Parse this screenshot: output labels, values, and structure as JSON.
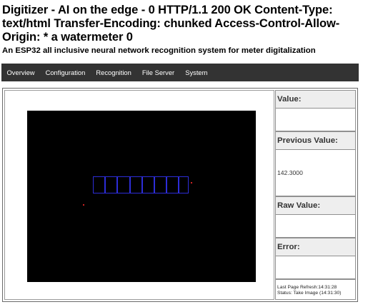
{
  "header": {
    "title": "Digitizer - AI on the edge - 0 HTTP/1.1 200 OK Content-Type: text/html Transfer-Encoding: chunked Access-Control-Allow-Origin: * a watermeter 0",
    "subtitle": "An ESP32 all inclusive neural network recognition system for meter digitalization"
  },
  "nav": {
    "items": [
      "Overview",
      "Configuration",
      "Recognition",
      "File Server",
      "System"
    ]
  },
  "values": {
    "value_label": "Value:",
    "value": "",
    "previous_label": "Previous Value:",
    "previous": "142.3000",
    "raw_label": "Raw Value:",
    "raw": "",
    "error_label": "Error:",
    "error": ""
  },
  "status": {
    "refresh": "Last Page Refresh:14:31:28",
    "status": "Status: Take Image (14:31:30)"
  },
  "colors": {
    "navbar": "#333333",
    "roi_digit": "#2d2dd8",
    "roi_marker": "#cc2222"
  }
}
